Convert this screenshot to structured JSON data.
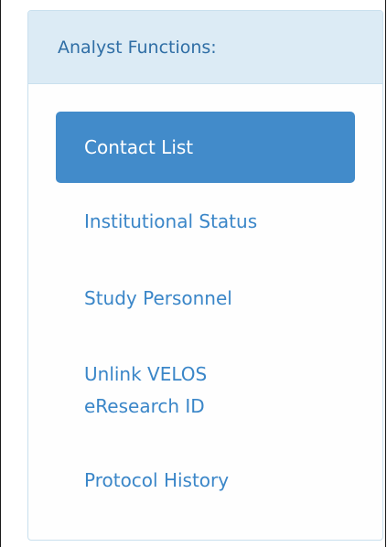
{
  "panel": {
    "title": "Analyst Functions:"
  },
  "nav": {
    "items": [
      {
        "label": "Contact List",
        "active": true
      },
      {
        "label": "Institutional Status",
        "active": false
      },
      {
        "label": "Study Personnel",
        "active": false
      },
      {
        "label": "Unlink VELOS\neResearch ID",
        "active": false
      },
      {
        "label": "Protocol History",
        "active": false
      }
    ]
  },
  "colors": {
    "header_bg": "#dcebf5",
    "active_bg": "#428bca",
    "link": "#3a86c8",
    "title": "#2f6ea5"
  }
}
